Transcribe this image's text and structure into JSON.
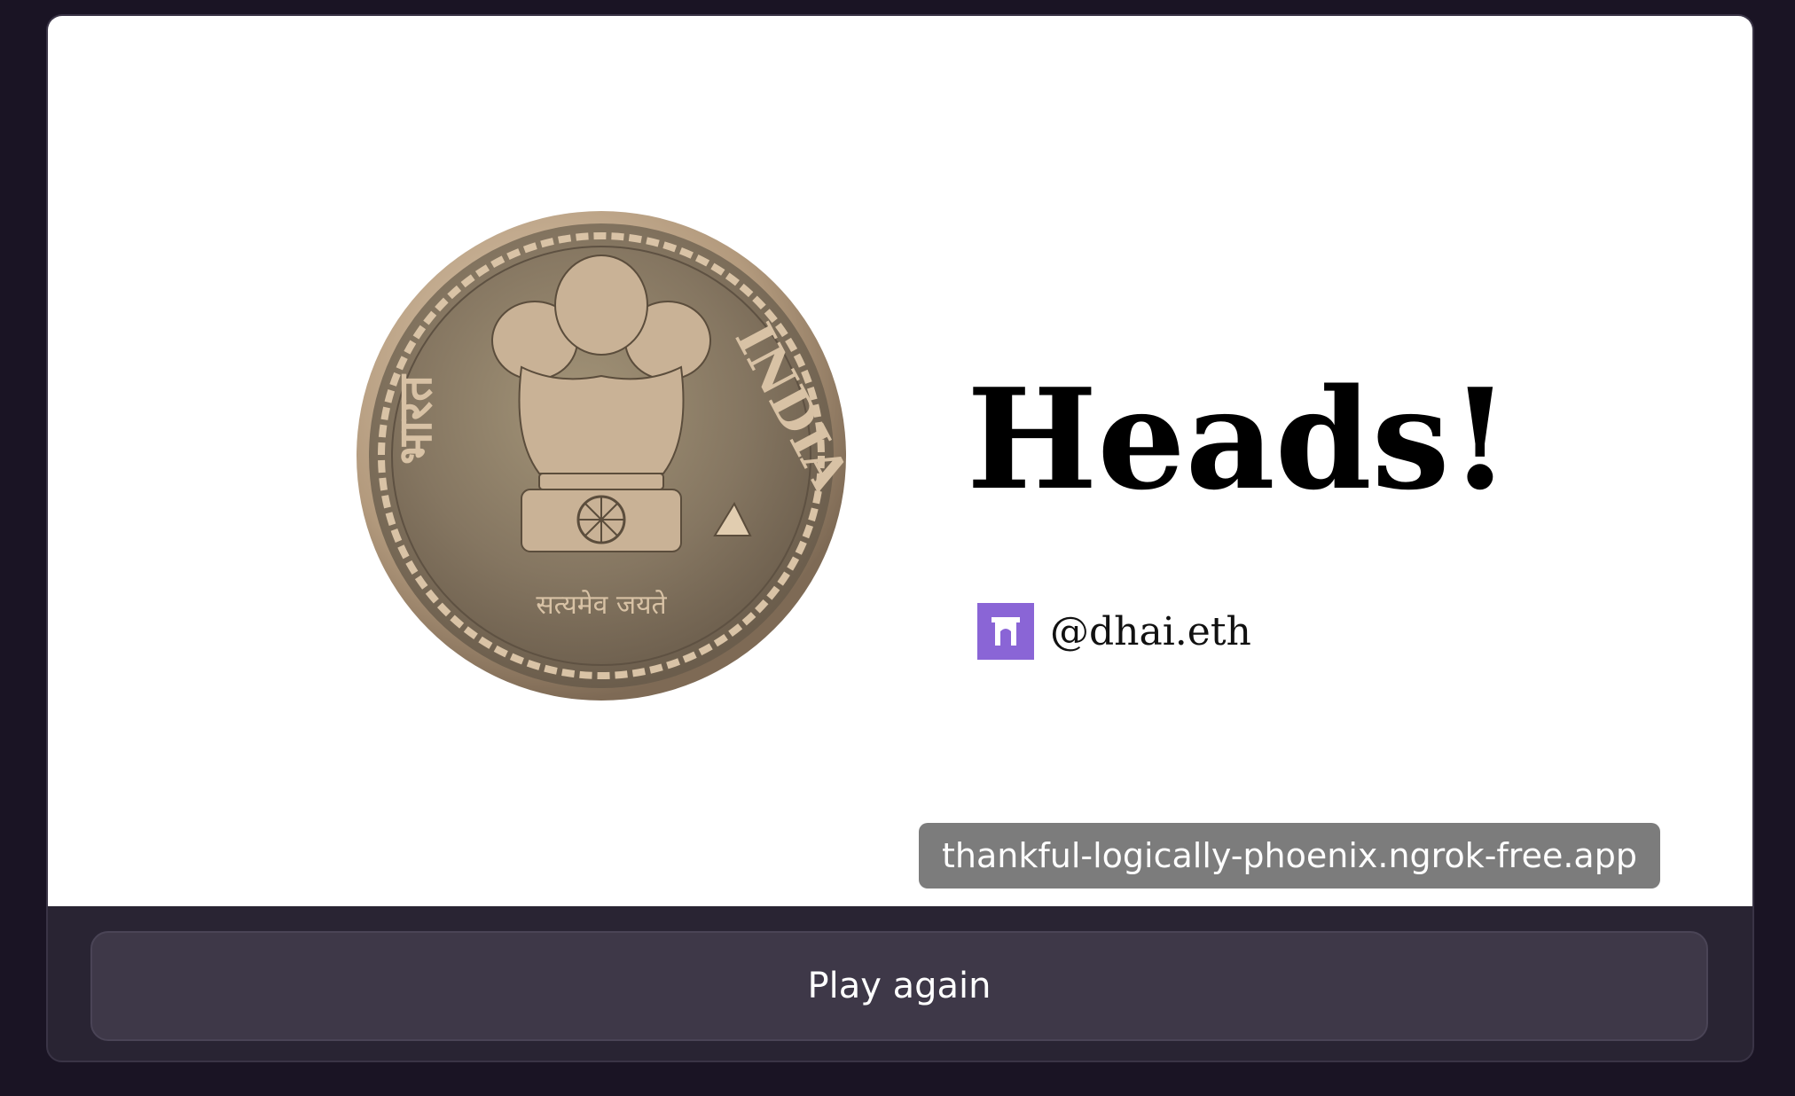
{
  "frame": {
    "result_title": "Heads!",
    "username": "@dhai.eth",
    "url_badge": "thankful-logically-phoenix.ngrok-free.app"
  },
  "coin": {
    "left_inscription": "भारत",
    "right_inscription": "INDIA",
    "motto": "सत्यमेव जयते",
    "colors": {
      "rim": "#b49a7e",
      "face": "#8a7a64",
      "emblem": "#c8b49a"
    }
  },
  "actions": {
    "play_again_label": "Play again"
  },
  "icons": {
    "avatar": "farcaster-arch-icon"
  },
  "colors": {
    "background": "#1a1424",
    "button": "#3e3848",
    "avatar": "#8a65d6",
    "badge": "#7c7c7c"
  }
}
